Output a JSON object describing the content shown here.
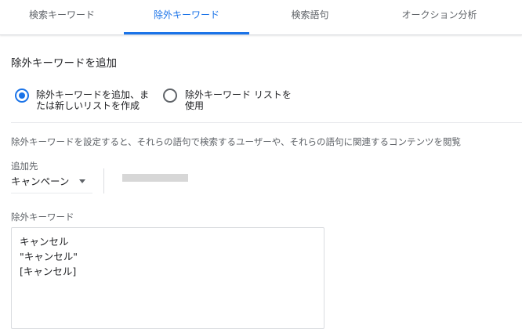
{
  "tabs": [
    {
      "label": "検索キーワード"
    },
    {
      "label": "除外キーワード"
    },
    {
      "label": "検索語句"
    },
    {
      "label": "オークション分析"
    }
  ],
  "active_tab": "除外キーワード",
  "section": {
    "title": "除外キーワードを追加"
  },
  "options": {
    "new_list": {
      "line1": "除外キーワードを追加、ま",
      "line2": "たは新しいリストを作成",
      "selected": true
    },
    "use_list": {
      "line1": "除外キーワード リストを",
      "line2": "使用",
      "selected": false
    }
  },
  "description": "除外キーワードを設定すると、それらの語句で検索するユーザーや、それらの語句に関連するコンテンツを閲覧",
  "add_to": {
    "label": "追加先",
    "value": "キャンペーン"
  },
  "keywords": {
    "label": "除外キーワード",
    "lines": [
      "キャンセル",
      "\"キャンセル\"",
      "[キャンセル]"
    ]
  },
  "colors": {
    "accent": "#1a73e8",
    "text": "#202124",
    "secondary_text": "#5f6368",
    "border": "#dadce0",
    "redacted": "#d7d7d7"
  }
}
